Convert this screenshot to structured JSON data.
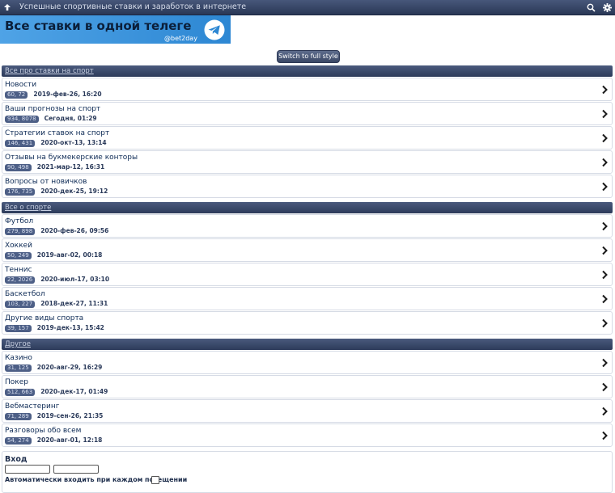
{
  "header": {
    "title": "Успешные спортивные ставки и заработок в интернете",
    "icons": {
      "up": "arrow-up-icon",
      "search": "search-icon",
      "settings": "gear-icon"
    }
  },
  "banner": {
    "text": "Все ставки в одной телеге",
    "handle": "@bet2day"
  },
  "switch_label": "Switch to full style",
  "categories": [
    {
      "title": "Все про ставки на спорт",
      "forums": [
        {
          "name": "Новости",
          "stats": "60, 72",
          "last": "2019-фев-26, 16:20"
        },
        {
          "name": "Ваши прогнозы на спорт",
          "stats": "934, 8078",
          "last": "Сегодня, 01:29"
        },
        {
          "name": "Стратегии ставок на спорт",
          "stats": "146, 431",
          "last": "2020-окт-13, 13:14"
        },
        {
          "name": "Отзывы на букмекерские конторы",
          "stats": "90, 498",
          "last": "2021-мар-12, 16:31"
        },
        {
          "name": "Вопросы от новичков",
          "stats": "176, 735",
          "last": "2020-дек-25, 19:12"
        }
      ]
    },
    {
      "title": "Все о спорте",
      "forums": [
        {
          "name": "Футбол",
          "stats": "279, 898",
          "last": "2020-фев-26, 09:56"
        },
        {
          "name": "Хоккей",
          "stats": "50, 249",
          "last": "2019-авг-02, 00:18"
        },
        {
          "name": "Теннис",
          "stats": "22, 2026",
          "last": "2020-июл-17, 03:10"
        },
        {
          "name": "Баскетбол",
          "stats": "103, 227",
          "last": "2018-дек-27, 11:31"
        },
        {
          "name": "Другие виды спорта",
          "stats": "39, 157",
          "last": "2019-дек-13, 15:42"
        }
      ]
    },
    {
      "title": "Другое",
      "forums": [
        {
          "name": "Казино",
          "stats": "31, 125",
          "last": "2020-авг-29, 16:29"
        },
        {
          "name": "Покер",
          "stats": "512, 663",
          "last": "2020-дек-17, 01:49"
        },
        {
          "name": "Вебмастеринг",
          "stats": "71, 289",
          "last": "2019-сен-26, 21:35"
        },
        {
          "name": "Разговоры обо всем",
          "stats": "54, 274",
          "last": "2020-авг-01, 12:18"
        }
      ]
    }
  ],
  "login": {
    "title": "Вход",
    "username_value": "",
    "password_value": "",
    "auto_login_label": "Автоматически входить при каждом посещении"
  }
}
